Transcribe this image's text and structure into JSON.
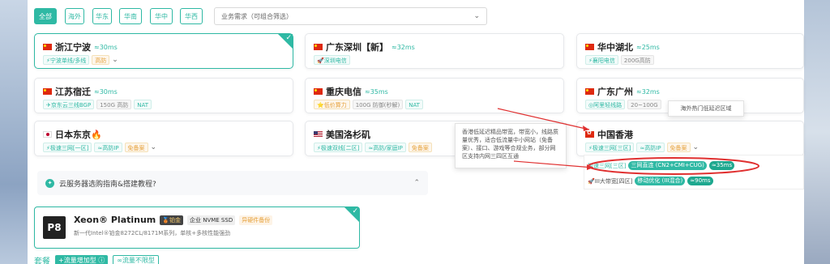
{
  "filters": [
    "全部",
    "海外",
    "华东",
    "华南",
    "华中",
    "华西"
  ],
  "select_placeholder": "业务需求（可组合筛选）",
  "cards": [
    {
      "title": "浙江宁波",
      "latency": "≈30ms",
      "flag": "cn",
      "tags": [
        {
          "t": "⚡宁波单线/多线",
          "c": "teal"
        },
        {
          "t": "高防",
          "c": "orange"
        }
      ]
    },
    {
      "title": "广东深圳【新】",
      "latency": "≈32ms",
      "flag": "cn",
      "tags": [
        {
          "t": "🚀深圳电信",
          "c": "teal"
        }
      ]
    },
    {
      "title": "华中湖北",
      "latency": "≈25ms",
      "flag": "cn",
      "tags": [
        {
          "t": "⚡襄阳电信",
          "c": "teal"
        },
        {
          "t": "200G高防",
          "c": "gray"
        }
      ]
    },
    {
      "title": "江苏宿迁",
      "latency": "≈30ms",
      "flag": "cn",
      "tags": [
        {
          "t": "✈京东云三线BGP",
          "c": "teal"
        },
        {
          "t": "150G 高防",
          "c": "gray"
        },
        {
          "t": "NAT",
          "c": "teal"
        }
      ]
    },
    {
      "title": "重庆电信",
      "latency": "≈35ms",
      "flag": "cn",
      "tags": [
        {
          "t": "⭐低价算力",
          "c": "orange"
        },
        {
          "t": "100G 防御(秒解)",
          "c": "gray"
        },
        {
          "t": "NAT",
          "c": "teal"
        }
      ]
    },
    {
      "title": "广东广州",
      "latency": "≈32ms",
      "flag": "cn",
      "tags": [
        {
          "t": "◎阿里轻线路",
          "c": "teal"
        },
        {
          "t": "20~100G",
          "c": "gray"
        }
      ]
    },
    {
      "title": "日本东京🔥",
      "latency": "",
      "flag": "jp",
      "tags": [
        {
          "t": "⚡极速三网[一区]",
          "c": "teal"
        },
        {
          "t": "≈高防IP",
          "c": "teal"
        },
        {
          "t": "免备案",
          "c": "orange"
        }
      ]
    },
    {
      "title": "美国洛杉矶",
      "latency": "",
      "flag": "us",
      "tags": [
        {
          "t": "⚡极速双线[二区]",
          "c": "teal"
        },
        {
          "t": "≈高防/家庭IP",
          "c": "teal"
        },
        {
          "t": "免备案",
          "c": "orange"
        }
      ]
    },
    {
      "title": "中国香港",
      "latency": "",
      "flag": "hk",
      "tags": [
        {
          "t": "⚡极速三网[三区]",
          "c": "teal"
        },
        {
          "t": "≈高防IP",
          "c": "teal"
        },
        {
          "t": "免备案",
          "c": "orange"
        }
      ]
    }
  ],
  "tooltip_text": "香港低延迟精品带宽，带宽小，线路质量优秀，适合低流量中小网站（免备案）、接口、游戏等合规业务，部分网区支持内网三四区互通",
  "tooltip2_text": "海外热门低延迟区域",
  "dropdown": {
    "row1": {
      "label": "极速三网[三区]",
      "b1": "三网直连 (CN2+CMI+CUG)",
      "b2": "≈35ms"
    },
    "row2": {
      "label": "🚀III大带宽[四区]",
      "b1": "移动优化 (III混合)",
      "b2": "≈90ms"
    }
  },
  "guide_text": "云服务器选购指南&搭建教程?",
  "cpu": {
    "badge": "P8",
    "name": "Xeon® Platinum",
    "tag_gold": "🥉铂金",
    "tag_ssd": "企业 NVME SSD",
    "tag_backup": "异硬件备份",
    "desc": "新一代Intel®铂金8272CL/8171M系列，单核+多核性能强劲"
  },
  "bottom": {
    "label": "套餐",
    "opt1": "+流量增加型 ⓘ",
    "opt2": "∞流量不限型"
  }
}
